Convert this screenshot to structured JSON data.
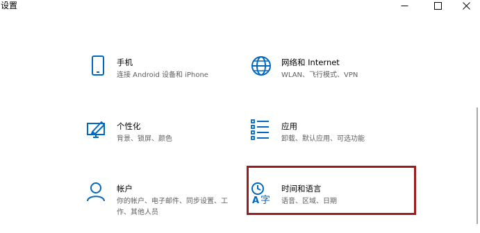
{
  "window": {
    "title": "设置",
    "controls": {
      "minimize": "minimize-icon",
      "maximize": "maximize-icon",
      "close": "close-icon"
    }
  },
  "accent_color": "#0067c0",
  "highlight_color": "#9b1c1c",
  "tiles": [
    {
      "name": "手机",
      "desc": "连接 Android 设备和 iPhone",
      "icon": "phone-icon"
    },
    {
      "name": "网络和 Internet",
      "desc": "WLAN、飞行模式、VPN",
      "icon": "globe-icon"
    },
    {
      "name": "个性化",
      "desc": "背景、锁屏、颜色",
      "icon": "personalization-icon"
    },
    {
      "name": "应用",
      "desc": "卸载、默认应用、可选功能",
      "icon": "apps-list-icon"
    },
    {
      "name": "帐户",
      "desc": "你的帐户、电子邮件、同步设置、工作、其他人员",
      "icon": "person-icon"
    },
    {
      "name": "时间和语言",
      "desc": "语音、区域、日期",
      "icon": "time-language-icon"
    }
  ]
}
